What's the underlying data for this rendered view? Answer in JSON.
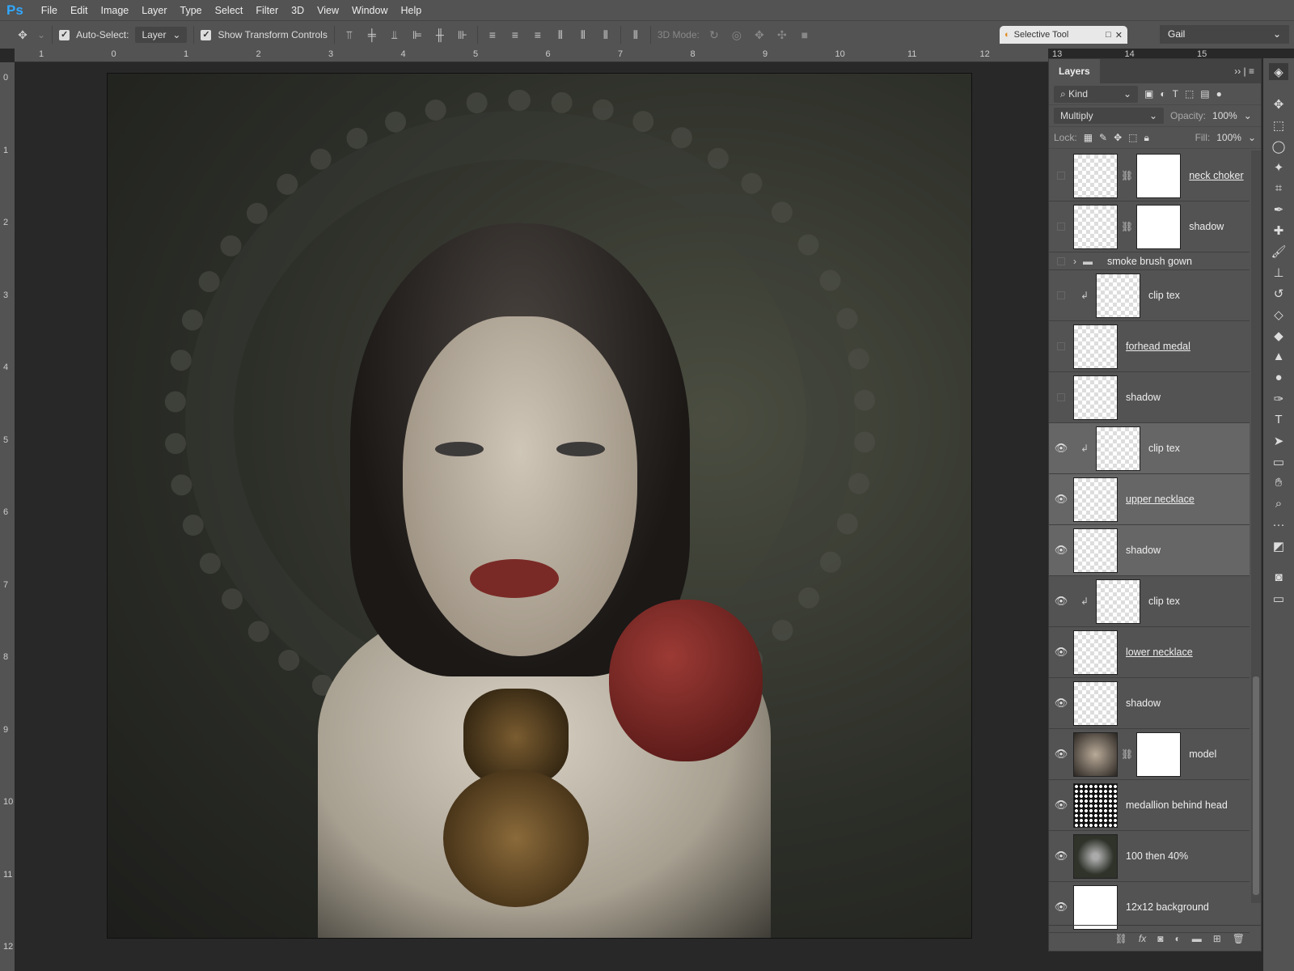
{
  "menu": [
    "File",
    "Edit",
    "Image",
    "Layer",
    "Type",
    "Select",
    "Filter",
    "3D",
    "View",
    "Window",
    "Help"
  ],
  "app_logo": "Ps",
  "options": {
    "auto_select_label": "Auto-Select:",
    "auto_select_checked": true,
    "auto_select_value": "Layer",
    "show_transform_label": "Show Transform Controls",
    "show_transform_checked": true,
    "mode_3d": "3D Mode:"
  },
  "plugin": {
    "title": "Selective Tool"
  },
  "workspace": "Gail",
  "ruler_top": [
    "1",
    "0",
    "1",
    "2",
    "3",
    "4",
    "5",
    "6",
    "7",
    "8",
    "9",
    "10",
    "11",
    "12",
    "13",
    "14",
    "15"
  ],
  "ruler_left": [
    "0",
    "1",
    "2",
    "3",
    "4",
    "5",
    "6",
    "7",
    "8",
    "9",
    "10",
    "11",
    "12"
  ],
  "layers_panel": {
    "title": "Layers",
    "filter": "Kind",
    "blend_mode": "Multiply",
    "opacity_label": "Opacity:",
    "opacity": "100%",
    "lock_label": "Lock:",
    "fill_label": "Fill:",
    "fill": "100%",
    "layers": [
      {
        "name": "neck choker",
        "visible": false,
        "underline": true,
        "mask": true
      },
      {
        "name": "shadow",
        "visible": false,
        "underline": false,
        "mask": true
      },
      {
        "name": "smoke brush gown",
        "visible": false,
        "group": true
      },
      {
        "name": "clip tex",
        "visible": false,
        "clip": true
      },
      {
        "name": "forhead medal",
        "visible": false,
        "underline": true
      },
      {
        "name": "shadow",
        "visible": false
      },
      {
        "name": "clip tex",
        "visible": true,
        "clip": true,
        "selected": true
      },
      {
        "name": "upper necklace",
        "visible": true,
        "underline": true,
        "selected": true
      },
      {
        "name": "shadow",
        "visible": true,
        "selected": true
      },
      {
        "name": "clip tex",
        "visible": true,
        "clip": true
      },
      {
        "name": "lower necklace",
        "visible": true,
        "underline": true
      },
      {
        "name": "shadow",
        "visible": true
      },
      {
        "name": "model",
        "visible": true,
        "mask": true,
        "thumb": "photo"
      },
      {
        "name": "medallion behind head",
        "visible": true,
        "thumb": "medallion"
      },
      {
        "name": "100 then 40%",
        "visible": true,
        "thumb": "dark"
      },
      {
        "name": "12x12 background",
        "visible": true,
        "thumb": "white"
      }
    ]
  }
}
